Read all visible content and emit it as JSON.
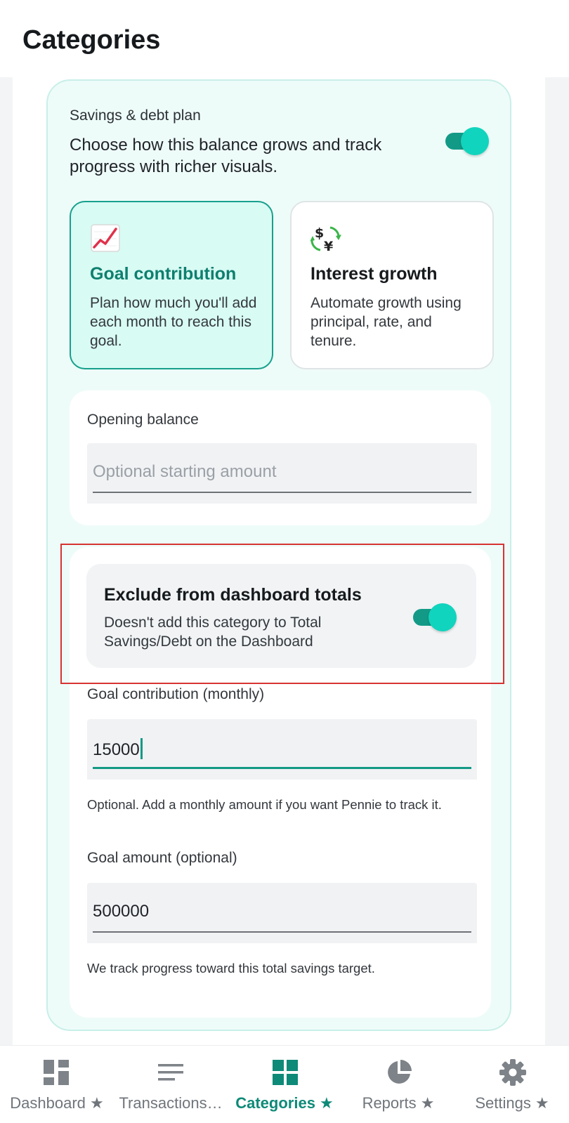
{
  "header": {
    "title": "Categories"
  },
  "plan": {
    "heading": "Savings & debt plan",
    "description": "Choose how this balance grows and track progress with richer visuals.",
    "enabled": true
  },
  "modes": [
    {
      "title": "Goal contribution",
      "description": "Plan how much you'll add each month to reach this goal.",
      "icon": "chart-increasing-icon",
      "selected": true
    },
    {
      "title": "Interest growth",
      "description": "Automate growth using principal, rate, and tenure.",
      "icon": "currency-exchange-icon",
      "selected": false
    }
  ],
  "opening_balance": {
    "label": "Opening balance",
    "value": "",
    "placeholder": "Optional starting amount"
  },
  "exclude": {
    "title": "Exclude from dashboard totals",
    "description": "Doesn't add this category to Total Savings/Debt on the Dashboard",
    "enabled": true
  },
  "goal_contribution": {
    "label": "Goal contribution (monthly)",
    "value": "15000",
    "hint": "Optional. Add a monthly amount if you want Pennie to track it."
  },
  "goal_amount": {
    "label": "Goal amount (optional)",
    "value": "500000",
    "hint": "We track progress toward this total savings target."
  },
  "nav": {
    "items": [
      {
        "label": "Dashboard ★",
        "icon": "dashboard-icon",
        "active": false
      },
      {
        "label": "Transactions…",
        "icon": "transactions-icon",
        "active": false
      },
      {
        "label": "Categories ★",
        "icon": "categories-icon",
        "active": true
      },
      {
        "label": "Reports ★",
        "icon": "reports-pie-icon",
        "active": false
      },
      {
        "label": "Settings ★",
        "icon": "settings-gear-icon",
        "active": false
      }
    ]
  },
  "colors": {
    "accent": "#139a87",
    "accent_light": "#10d4bd",
    "card_bg": "#eefcf9",
    "highlight": "#d73333"
  }
}
